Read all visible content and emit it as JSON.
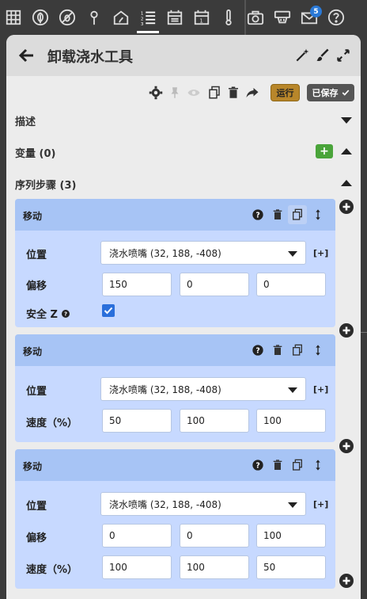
{
  "nav": {
    "badge_count": "5",
    "icons": [
      "grid-icon",
      "leaf-icon",
      "no-bug-icon",
      "map-pin-icon",
      "garden-icon",
      "sequence-list-icon",
      "calendar-icon",
      "calendar-day-icon",
      "thermometer-icon",
      "camera-icon",
      "device-icon",
      "mail-icon",
      "help-icon"
    ]
  },
  "header": {
    "title": "卸载浇水工具"
  },
  "toolbar": {
    "run_label": "运行",
    "saved_label": "已保存"
  },
  "sections": {
    "description": "描述",
    "variables": "变量 (0)",
    "steps": "序列步骤 (3)"
  },
  "labels": {
    "position": "位置",
    "offset": "偏移",
    "safe_z": "安全 Z",
    "speed": "速度（%）",
    "add_bracket": "[+]"
  },
  "steps": [
    {
      "name": "移动",
      "location": "浇水喷嘴 (32, 188, -408)",
      "offset": [
        "150",
        "0",
        "0"
      ],
      "safe_z": true
    },
    {
      "name": "移动",
      "location": "浇水喷嘴 (32, 188, -408)",
      "speed": [
        "50",
        "100",
        "100"
      ]
    },
    {
      "name": "移动",
      "location": "浇水喷嘴 (32, 188, -408)",
      "offset": [
        "0",
        "0",
        "100"
      ],
      "speed": [
        "100",
        "100",
        "50"
      ]
    }
  ]
}
